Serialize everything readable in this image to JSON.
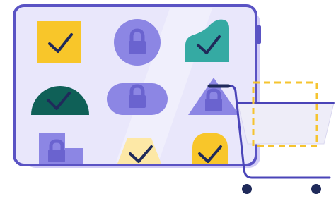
{
  "illustration": {
    "colors": {
      "background": "#ffffff",
      "panel_fill": "#e9e7fb",
      "panel_stroke": "#5a53c4",
      "panel_shadow": "#d2cdf6",
      "purple": "#8c86e4",
      "purple_dark": "#6a63cf",
      "yellow": "#f8c62a",
      "yellow_light": "#fde8a6",
      "teal": "#35aaa3",
      "teal_dark": "#0f6057",
      "check": "#1f2a5a",
      "cart_stroke": "#4a44b8",
      "cart_basket": "#eeedf8",
      "dashed_box": "#f5c430"
    },
    "tiles": [
      {
        "shape": "square",
        "color": "yellow",
        "icon": "check-icon"
      },
      {
        "shape": "circle",
        "color": "purple",
        "icon": "lock-icon"
      },
      {
        "shape": "wave",
        "color": "teal",
        "icon": "check-icon"
      },
      {
        "shape": "semicircle",
        "color": "teal_dark",
        "icon": "check-icon"
      },
      {
        "shape": "pill",
        "color": "purple",
        "icon": "lock-icon"
      },
      {
        "shape": "triangle",
        "color": "purple",
        "icon": "lock-icon"
      },
      {
        "shape": "l-shape",
        "color": "purple",
        "icon": "lock-icon"
      },
      {
        "shape": "trapezoid",
        "color": "yellow_light",
        "icon": "check-icon"
      },
      {
        "shape": "arch",
        "color": "yellow",
        "icon": "check-icon"
      }
    ],
    "cart": {
      "icon": "shopping-cart-icon",
      "drop_zone": "dashed-drop-zone"
    }
  }
}
